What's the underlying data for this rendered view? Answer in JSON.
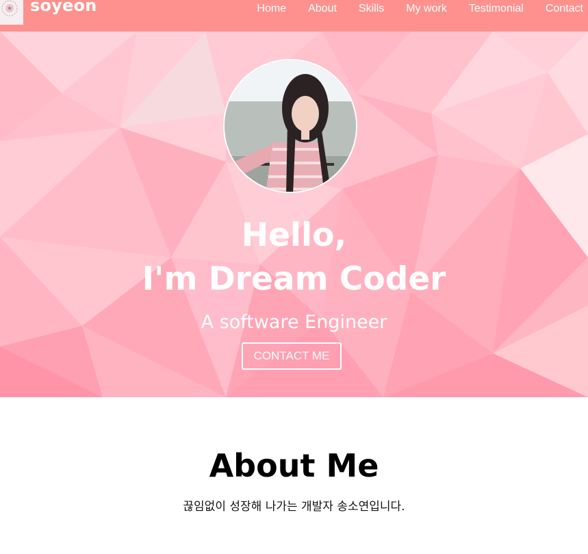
{
  "navbar": {
    "logo_text": "soyeon",
    "menu": [
      {
        "label": "Home"
      },
      {
        "label": "About"
      },
      {
        "label": "Skills"
      },
      {
        "label": "My work"
      },
      {
        "label": "Testimonial"
      },
      {
        "label": "Contact"
      }
    ]
  },
  "hero": {
    "hello_line1": "Hello,",
    "hello_line2": "I'm Dream Coder",
    "subtitle": "A software Engineer",
    "contact_button": "CONTACT ME"
  },
  "about": {
    "title": "About Me",
    "description": "끊임없이 성장해 나가는 개발자 송소연입니다."
  },
  "colors": {
    "navbar_bg": "#fe918d",
    "hero_base": "#ffc1cc",
    "text_light": "#ffffff",
    "text_dark": "#000000"
  }
}
